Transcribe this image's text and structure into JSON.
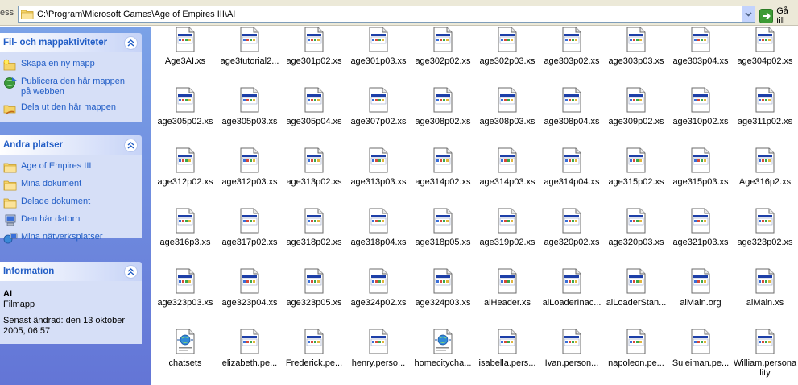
{
  "address": {
    "label_partial": "ess",
    "path": "C:\\Program\\Microsoft Games\\Age of Empires III\\AI",
    "go_label": "Gå till"
  },
  "taskpane": {
    "file_tasks": {
      "title": "Fil- och mappaktiviteter",
      "items": [
        {
          "label": "Skapa en ny mapp",
          "icon": "new-folder-icon"
        },
        {
          "label": "Publicera den här mappen på webben",
          "icon": "publish-web-icon"
        },
        {
          "label": "Dela ut den här mappen",
          "icon": "share-folder-icon"
        }
      ]
    },
    "other_places": {
      "title": "Andra platser",
      "items": [
        {
          "label": "Age of Empires III",
          "icon": "folder-icon"
        },
        {
          "label": "Mina dokument",
          "icon": "folder-icon"
        },
        {
          "label": "Delade dokument",
          "icon": "folder-icon"
        },
        {
          "label": "Den här datorn",
          "icon": "computer-icon"
        },
        {
          "label": "Mina nätverksplatser",
          "icon": "network-icon"
        }
      ]
    },
    "information": {
      "title": "Information",
      "name": "AI",
      "type": "Filmapp",
      "modified": "Senast ändrad: den 13 oktober 2005, 06:57"
    }
  },
  "files": [
    {
      "name": "Age3AI.xs",
      "icon": "xs-file-icon"
    },
    {
      "name": "age3tutorial2...",
      "icon": "xs-file-icon"
    },
    {
      "name": "age301p02.xs",
      "icon": "xs-file-icon"
    },
    {
      "name": "age301p03.xs",
      "icon": "xs-file-icon"
    },
    {
      "name": "age302p02.xs",
      "icon": "xs-file-icon"
    },
    {
      "name": "age302p03.xs",
      "icon": "xs-file-icon"
    },
    {
      "name": "age303p02.xs",
      "icon": "xs-file-icon"
    },
    {
      "name": "age303p03.xs",
      "icon": "xs-file-icon"
    },
    {
      "name": "age303p04.xs",
      "icon": "xs-file-icon"
    },
    {
      "name": "age304p02.xs",
      "icon": "xs-file-icon"
    },
    {
      "name": "age305p02.xs",
      "icon": "xs-file-icon"
    },
    {
      "name": "age305p03.xs",
      "icon": "xs-file-icon"
    },
    {
      "name": "age305p04.xs",
      "icon": "xs-file-icon"
    },
    {
      "name": "age307p02.xs",
      "icon": "xs-file-icon"
    },
    {
      "name": "age308p02.xs",
      "icon": "xs-file-icon"
    },
    {
      "name": "age308p03.xs",
      "icon": "xs-file-icon"
    },
    {
      "name": "age308p04.xs",
      "icon": "xs-file-icon"
    },
    {
      "name": "age309p02.xs",
      "icon": "xs-file-icon"
    },
    {
      "name": "age310p02.xs",
      "icon": "xs-file-icon"
    },
    {
      "name": "age311p02.xs",
      "icon": "xs-file-icon"
    },
    {
      "name": "age312p02.xs",
      "icon": "xs-file-icon"
    },
    {
      "name": "age312p03.xs",
      "icon": "xs-file-icon"
    },
    {
      "name": "age313p02.xs",
      "icon": "xs-file-icon"
    },
    {
      "name": "age313p03.xs",
      "icon": "xs-file-icon"
    },
    {
      "name": "age314p02.xs",
      "icon": "xs-file-icon"
    },
    {
      "name": "age314p03.xs",
      "icon": "xs-file-icon"
    },
    {
      "name": "age314p04.xs",
      "icon": "xs-file-icon"
    },
    {
      "name": "age315p02.xs",
      "icon": "xs-file-icon"
    },
    {
      "name": "age315p03.xs",
      "icon": "xs-file-icon"
    },
    {
      "name": "Age316p2.xs",
      "icon": "xs-file-icon"
    },
    {
      "name": "age316p3.xs",
      "icon": "xs-file-icon"
    },
    {
      "name": "age317p02.xs",
      "icon": "xs-file-icon"
    },
    {
      "name": "age318p02.xs",
      "icon": "xs-file-icon"
    },
    {
      "name": "age318p04.xs",
      "icon": "xs-file-icon"
    },
    {
      "name": "age318p05.xs",
      "icon": "xs-file-icon"
    },
    {
      "name": "age319p02.xs",
      "icon": "xs-file-icon"
    },
    {
      "name": "age320p02.xs",
      "icon": "xs-file-icon"
    },
    {
      "name": "age320p03.xs",
      "icon": "xs-file-icon"
    },
    {
      "name": "age321p03.xs",
      "icon": "xs-file-icon"
    },
    {
      "name": "age323p02.xs",
      "icon": "xs-file-icon"
    },
    {
      "name": "age323p03.xs",
      "icon": "xs-file-icon"
    },
    {
      "name": "age323p04.xs",
      "icon": "xs-file-icon"
    },
    {
      "name": "age323p05.xs",
      "icon": "xs-file-icon"
    },
    {
      "name": "age324p02.xs",
      "icon": "xs-file-icon"
    },
    {
      "name": "age324p03.xs",
      "icon": "xs-file-icon"
    },
    {
      "name": "aiHeader.xs",
      "icon": "xs-file-icon"
    },
    {
      "name": "aiLoaderInac...",
      "icon": "xs-file-icon"
    },
    {
      "name": "aiLoaderStan...",
      "icon": "xs-file-icon"
    },
    {
      "name": "aiMain.org",
      "icon": "xs-file-icon"
    },
    {
      "name": "aiMain.xs",
      "icon": "xs-file-icon"
    },
    {
      "name": "chatsets",
      "icon": "web-file-icon"
    },
    {
      "name": "elizabeth.pe...",
      "icon": "xs-file-icon"
    },
    {
      "name": "Frederick.pe...",
      "icon": "xs-file-icon"
    },
    {
      "name": "henry.perso...",
      "icon": "xs-file-icon"
    },
    {
      "name": "homecitycha...",
      "icon": "web-file-icon"
    },
    {
      "name": "isabella.pers...",
      "icon": "xs-file-icon"
    },
    {
      "name": "Ivan.person...",
      "icon": "xs-file-icon"
    },
    {
      "name": "napoleon.pe...",
      "icon": "xs-file-icon"
    },
    {
      "name": "Suleiman.pe...",
      "icon": "xs-file-icon"
    },
    {
      "name": "William.personality",
      "icon": "xs-file-icon"
    }
  ],
  "colors": {
    "taskpane_bg": "#6b8ae0",
    "panel_title": "#215dc6",
    "panel_body": "#d6dff7"
  }
}
